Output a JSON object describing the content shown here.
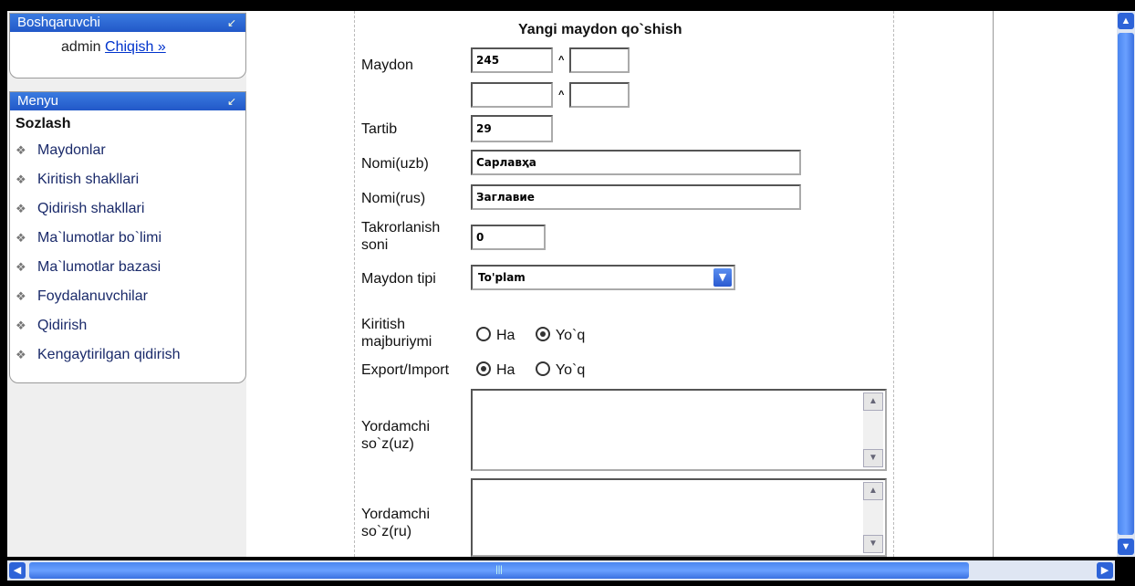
{
  "sidebar": {
    "panel1": {
      "title": "Boshqaruvchi",
      "user": "admin",
      "logout": "Chiqish »"
    },
    "panel2": {
      "title": "Menyu",
      "section": "Sozlash",
      "items": [
        "Maydonlar",
        "Kiritish shakllari",
        "Qidirish shakllari",
        "Ma`lumotlar bo`limi",
        "Ma`lumotlar bazasi",
        "Foydalanuvchilar",
        "Qidirish",
        "Kengaytirilgan qidirish"
      ]
    }
  },
  "form": {
    "title": "Yangi maydon qo`shish",
    "maydon_label": "Maydon",
    "maydon_value_1": "245",
    "maydon_value_2": "",
    "maydon_value_3": "",
    "maydon_value_4": "",
    "caret": "^",
    "tartib_label": "Tartib",
    "tartib_value": "29",
    "nomi_uzb_label": "Nomi(uzb)",
    "nomi_uzb_value": "Сарлавҳа",
    "nomi_rus_label": "Nomi(rus)",
    "nomi_rus_value": "Заглавие",
    "takror_label_1": "Takrorlanish",
    "takror_label_2": "soni",
    "takror_value": "0",
    "tipi_label": "Maydon tipi",
    "tipi_value": "To'plam",
    "kiritish_label_1": "Kiritish",
    "kiritish_label_2": "majburiymi",
    "export_label": "Export/Import",
    "ha": "Ha",
    "yoq": "Yo`q",
    "kiritish_selected": "Yo`q",
    "export_selected": "Ha",
    "yordam_uz_label_1": "Yordamchi",
    "yordam_uz_label_2": "so`z(uz)",
    "yordam_ru_label_1": "Yordamchi",
    "yordam_ru_label_2": "so`z(ru)"
  },
  "icons": {
    "collapse": "collapse-arrow-icon",
    "menu_item": "menu-item-icon",
    "dropdown": "dropdown-arrow-icon",
    "scroll_up": "scroll-up-icon",
    "scroll_down": "scroll-down-icon",
    "scroll_left": "scroll-left-icon",
    "scroll_right": "scroll-right-icon"
  },
  "colors": {
    "accent": "#2d63d8",
    "link": "#0033cc",
    "sidebar_bg": "#efefef"
  }
}
